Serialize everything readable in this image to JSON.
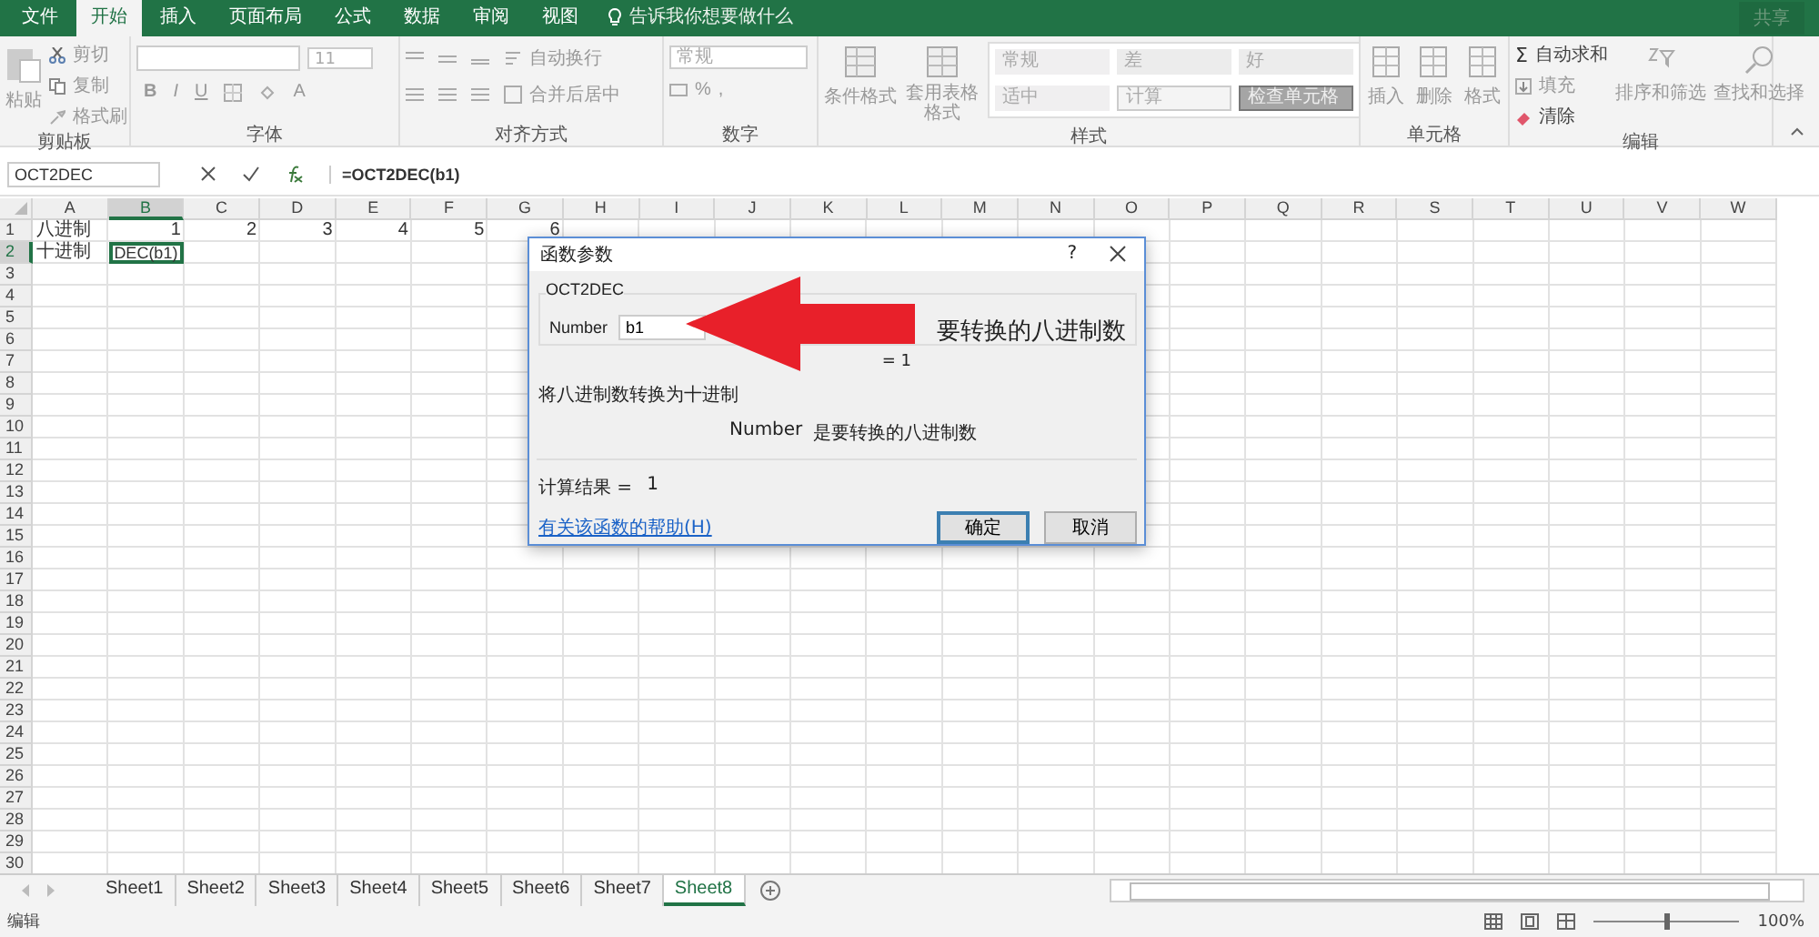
{
  "menu_tabs": [
    {
      "label": "文件",
      "selected": false
    },
    {
      "label": "开始",
      "selected": true
    },
    {
      "label": "插入",
      "selected": false
    },
    {
      "label": "页面布局",
      "selected": false
    },
    {
      "label": "公式",
      "selected": false
    },
    {
      "label": "数据",
      "selected": false
    },
    {
      "label": "审阅",
      "selected": false
    },
    {
      "label": "视图",
      "selected": false
    }
  ],
  "tell_me": "告诉我你想要做什么",
  "share_button": "共享",
  "ribbon": {
    "clipboard": {
      "paste": "粘贴",
      "cut": "剪切",
      "copy": "复制",
      "format_painter": "格式刷",
      "label": "剪贴板"
    },
    "font": {
      "size": "11",
      "bold": "B",
      "italic": "I",
      "underline": "U",
      "font_color": "A",
      "label": "字体"
    },
    "alignment": {
      "wrap": "自动换行",
      "merge": "合并后居中",
      "label": "对齐方式"
    },
    "number": {
      "format": "常规",
      "percent": "%",
      "comma": ",",
      "label": "数字"
    },
    "styles": {
      "conditional": "条件格式",
      "table": "套用表格格式",
      "cell_styles": [
        {
          "label": "常规",
          "kind": "normal"
        },
        {
          "label": "差",
          "kind": "bad"
        },
        {
          "label": "好",
          "kind": "good"
        },
        {
          "label": "适中",
          "kind": "neutral"
        },
        {
          "label": "计算",
          "kind": "calculation"
        },
        {
          "label": "检查单元格",
          "kind": "check"
        }
      ],
      "label": "样式"
    },
    "cells": {
      "insert": "插入",
      "delete": "删除",
      "format": "格式",
      "label": "单元格"
    },
    "editing": {
      "autosum_symbol": "Σ",
      "autosum": "自动求和",
      "fill": "填充",
      "clear": "清除",
      "sort": "排序和筛选",
      "find": "查找和选择",
      "label": "编辑"
    }
  },
  "formula_bar": {
    "name_box": "OCT2DEC",
    "formula": "=OCT2DEC(b1)"
  },
  "columns": [
    "A",
    "B",
    "C",
    "D",
    "E",
    "F",
    "G",
    "H",
    "I",
    "J",
    "K",
    "L",
    "M",
    "N",
    "O",
    "P",
    "Q",
    "R",
    "S",
    "T",
    "U",
    "V",
    "W"
  ],
  "rows": [
    {
      "number": "1",
      "cells": [
        {
          "text": "八进制",
          "kind": "text",
          "selected": false
        },
        {
          "text": "1",
          "kind": "number",
          "selected": false
        },
        {
          "text": "2",
          "kind": "number",
          "selected": false
        },
        {
          "text": "3",
          "kind": "number",
          "selected": false
        },
        {
          "text": "4",
          "kind": "number",
          "selected": false
        },
        {
          "text": "5",
          "kind": "number",
          "selected": false
        },
        {
          "text": "6",
          "kind": "number",
          "selected": false
        }
      ]
    },
    {
      "number": "2",
      "cells": [
        {
          "text": "十进制",
          "kind": "text",
          "selected": false
        },
        {
          "text": "DEC(b1)",
          "kind": "text",
          "selected": true
        }
      ]
    },
    {
      "number": "3"
    },
    {
      "number": "4"
    },
    {
      "number": "5"
    },
    {
      "number": "6"
    },
    {
      "number": "7"
    },
    {
      "number": "8"
    },
    {
      "number": "9"
    },
    {
      "number": "10"
    },
    {
      "number": "11"
    },
    {
      "number": "12"
    },
    {
      "number": "13"
    },
    {
      "number": "14"
    },
    {
      "number": "15"
    },
    {
      "number": "16"
    },
    {
      "number": "17"
    },
    {
      "number": "18"
    },
    {
      "number": "19"
    },
    {
      "number": "20"
    },
    {
      "number": "21"
    },
    {
      "number": "22"
    },
    {
      "number": "23"
    },
    {
      "number": "24"
    },
    {
      "number": "25"
    },
    {
      "number": "26"
    },
    {
      "number": "27"
    },
    {
      "number": "28"
    },
    {
      "number": "29"
    },
    {
      "number": "30"
    }
  ],
  "dialog": {
    "title": "函数参数",
    "help": "?",
    "function_name": "OCT2DEC",
    "arg_label": "Number",
    "arg_value": "b1",
    "arg_description_large": "要转换的八进制数",
    "arg_result": "= 1",
    "description": "将八进制数转换为十进制",
    "arg_help_name": "Number",
    "arg_help_text": "是要转换的八进制数",
    "result_label": "计算结果 =",
    "result_value": "1",
    "help_link": "有关该函数的帮助(H)",
    "ok": "确定",
    "cancel": "取消"
  },
  "sheet_tabs": [
    {
      "label": "Sheet1",
      "selected": false
    },
    {
      "label": "Sheet2",
      "selected": false
    },
    {
      "label": "Sheet3",
      "selected": false
    },
    {
      "label": "Sheet4",
      "selected": false
    },
    {
      "label": "Sheet5",
      "selected": false
    },
    {
      "label": "Sheet6",
      "selected": false
    },
    {
      "label": "Sheet7",
      "selected": false
    },
    {
      "label": "Sheet8",
      "selected": true
    }
  ],
  "status_bar": {
    "mode": "编辑",
    "zoom_slider": {
      "level": 0.5
    },
    "zoom": "100%"
  }
}
